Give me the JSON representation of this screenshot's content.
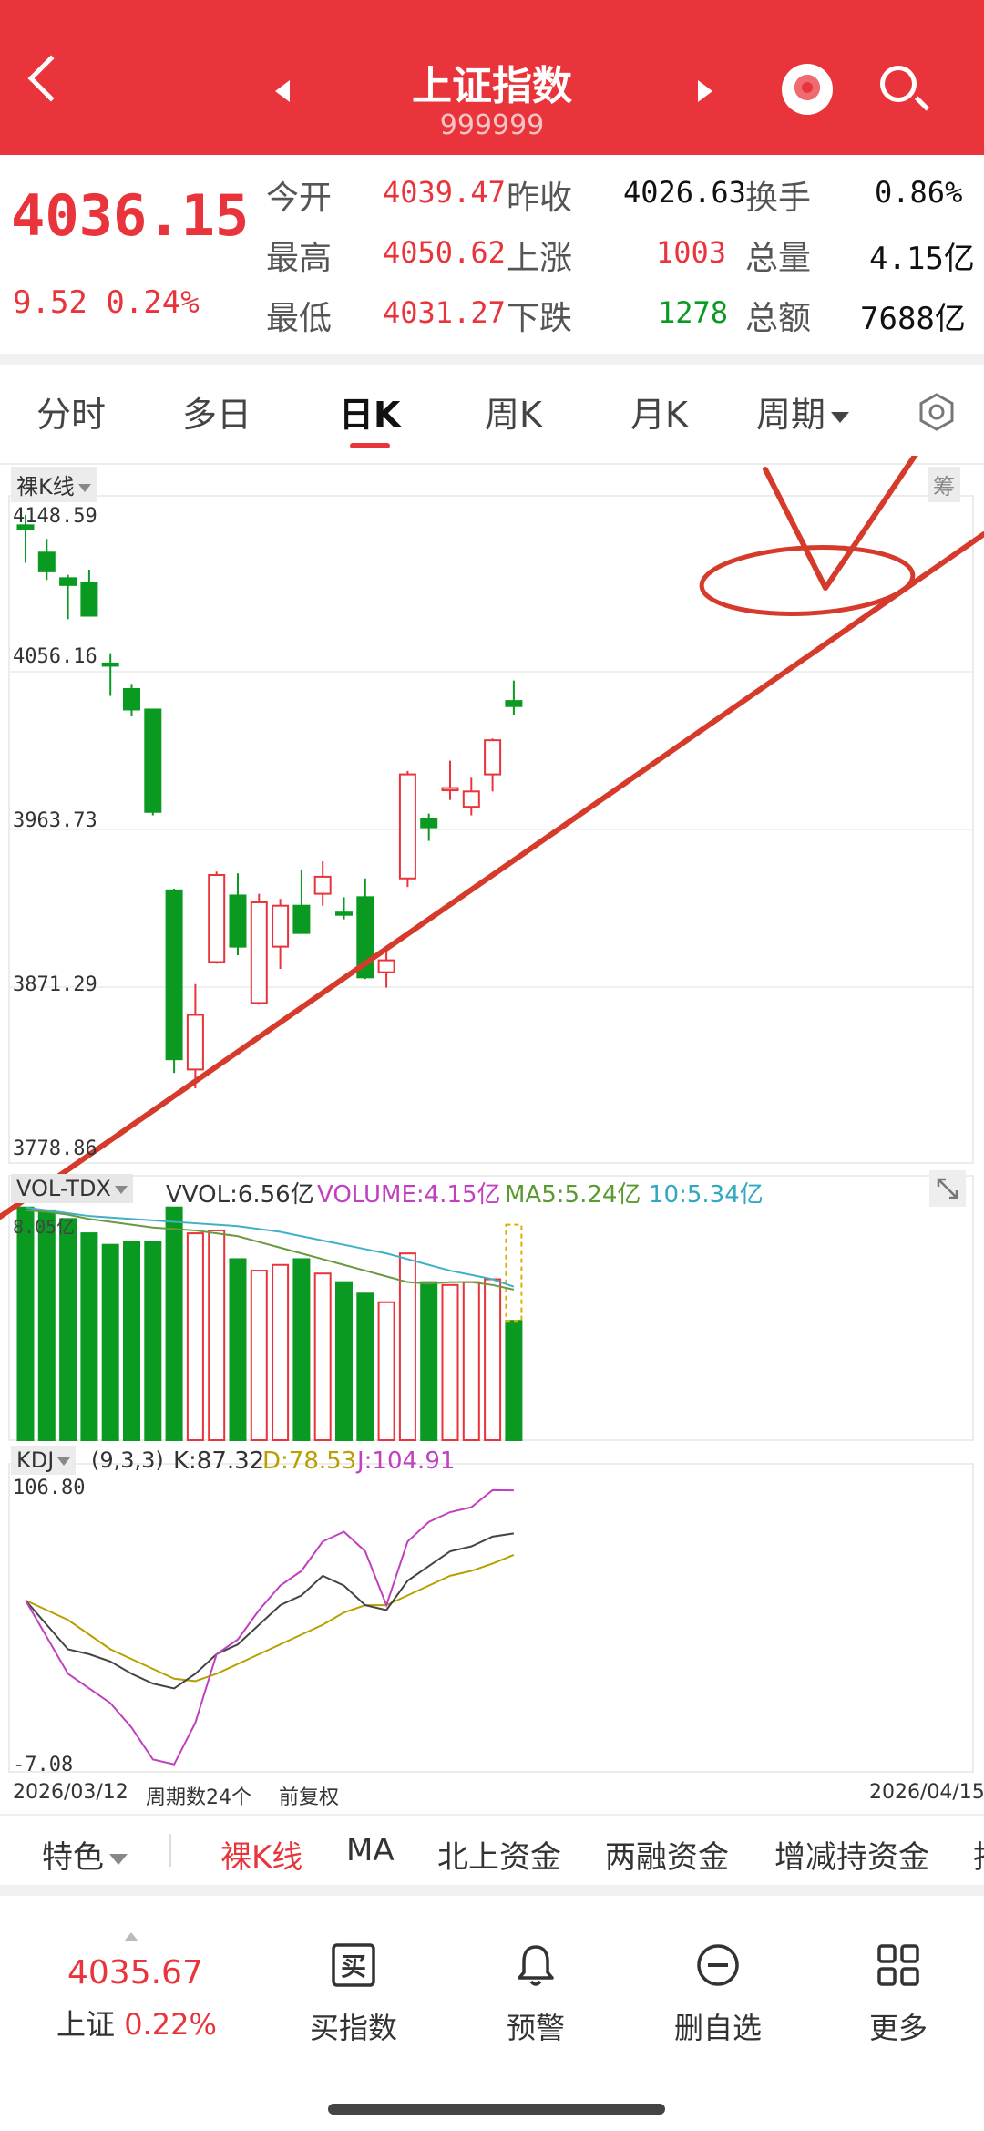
{
  "header": {
    "title": "上证指数",
    "code": "999999"
  },
  "quote": {
    "price": "4036.15",
    "change": "9.52  0.24%",
    "rows": [
      {
        "l1": "今开",
        "v1": "4039.47",
        "l2": "昨收",
        "v2": "4026.63",
        "l3": "换手",
        "v3": "0.86%"
      },
      {
        "l1": "最高",
        "v1": "4050.62",
        "l2": "上涨",
        "v2": "1003",
        "l3": "总量",
        "v3": "4.15亿"
      },
      {
        "l1": "最低",
        "v1": "4031.27",
        "l2": "下跌",
        "v2": "1278",
        "l3": "总额",
        "v3": "7688亿"
      }
    ]
  },
  "tabs": [
    "分时",
    "多日",
    "日K",
    "周K",
    "月K",
    "周期"
  ],
  "active_tab": "日K",
  "chart": {
    "kline_tag": "裸K线",
    "chip_tag": "筹",
    "price_labels": [
      "4148.59",
      "4056.16",
      "3963.73",
      "3871.29",
      "3778.86"
    ],
    "vol_tag": "VOL-TDX",
    "vol_legend": {
      "vvol": "VVOL:6.56亿",
      "volume": "VOLUME:4.15亿",
      "ma5": "MA5:5.24亿",
      "ma10": "10:5.34亿"
    },
    "vol_top_label": "8.05亿",
    "kdj_tag": "KDJ",
    "kdj_legend": {
      "params": "(9,3,3)",
      "k": "K:87.32",
      "d": "D:78.53",
      "j": "J:104.91"
    },
    "kdj_labels": [
      "106.80",
      "-7.08"
    ],
    "date_start": "2026/03/12",
    "period_count": "周期数24个",
    "adjust": "前复权",
    "date_end": "2026/04/15",
    "colors": {
      "up": "#e8343a",
      "down": "#0a9a21",
      "k": "#444444",
      "d": "#b8a000",
      "j": "#c040c0",
      "ma5": "#6a9a40",
      "ma10": "#40b0c8"
    }
  },
  "chart_data": {
    "type": "candlestick",
    "ylim": [
      3778.86,
      4148.59
    ],
    "candles": [
      {
        "o": 4142,
        "c": 4140,
        "h": 4148,
        "l": 4120
      },
      {
        "o": 4126,
        "c": 4115,
        "h": 4134,
        "l": 4110
      },
      {
        "o": 4111,
        "c": 4107,
        "h": 4113,
        "l": 4087
      },
      {
        "o": 4108,
        "c": 4089,
        "h": 4116,
        "l": 4089
      },
      {
        "o": 4061,
        "c": 4061,
        "h": 4067,
        "l": 4042
      },
      {
        "o": 4046,
        "c": 4034,
        "h": 4049,
        "l": 4030
      },
      {
        "o": 4034,
        "c": 3974,
        "h": 4034,
        "l": 3972
      },
      {
        "o": 3928,
        "c": 3829,
        "h": 3929,
        "l": 3821
      },
      {
        "o": 3823,
        "c": 3855,
        "h": 3873,
        "l": 3812
      },
      {
        "o": 3886,
        "c": 3937,
        "h": 3939,
        "l": 3885
      },
      {
        "o": 3925,
        "c": 3895,
        "h": 3938,
        "l": 3890
      },
      {
        "o": 3862,
        "c": 3921,
        "h": 3926,
        "l": 3861
      },
      {
        "o": 3895,
        "c": 3919,
        "h": 3923,
        "l": 3882
      },
      {
        "o": 3919,
        "c": 3903,
        "h": 3940,
        "l": 3903
      },
      {
        "o": 3926,
        "c": 3936,
        "h": 3945,
        "l": 3919
      },
      {
        "o": 3915,
        "c": 3915,
        "h": 3924,
        "l": 3911
      },
      {
        "o": 3924,
        "c": 3877,
        "h": 3935,
        "l": 3876
      },
      {
        "o": 3880,
        "c": 3887,
        "h": 3895,
        "l": 3871
      },
      {
        "o": 3935,
        "c": 3996,
        "h": 3998,
        "l": 3930
      },
      {
        "o": 3970,
        "c": 3965,
        "h": 3973,
        "l": 3957
      },
      {
        "o": 3987,
        "c": 3988,
        "h": 4004,
        "l": 3981
      },
      {
        "o": 3977,
        "c": 3986,
        "h": 3994,
        "l": 3972
      },
      {
        "o": 3996,
        "c": 4016,
        "h": 4017,
        "l": 3986
      },
      {
        "o": 4039,
        "c": 4036,
        "h": 4051,
        "l": 4031
      }
    ],
    "volume": [
      8.1,
      8.0,
      7.7,
      7.2,
      6.8,
      6.9,
      6.9,
      8.1,
      7.2,
      7.3,
      6.3,
      5.9,
      6.1,
      6.3,
      5.8,
      5.5,
      5.1,
      4.8,
      6.5,
      5.5,
      5.4,
      5.5,
      5.6,
      4.15
    ],
    "vol_max": 8.25,
    "ma5": [
      8.0,
      7.95,
      7.85,
      7.7,
      7.6,
      7.5,
      7.4,
      7.35,
      7.3,
      7.2,
      7.1,
      6.9,
      6.7,
      6.5,
      6.3,
      6.1,
      5.9,
      5.7,
      5.5,
      5.45,
      5.5,
      5.5,
      5.4,
      5.24
    ],
    "ma10": [
      8.1,
      8.0,
      7.9,
      7.8,
      7.75,
      7.7,
      7.65,
      7.6,
      7.55,
      7.5,
      7.45,
      7.35,
      7.25,
      7.1,
      6.95,
      6.8,
      6.65,
      6.5,
      6.3,
      6.1,
      5.9,
      5.75,
      5.6,
      5.34
    ],
    "kdj_ylim": [
      -7.08,
      106.8
    ],
    "k": [
      60,
      50,
      40,
      38,
      35,
      30,
      26,
      24,
      30,
      38,
      42,
      50,
      58,
      62,
      70,
      66,
      58,
      56,
      68,
      74,
      80,
      82,
      86,
      87.32
    ],
    "d": [
      60,
      56,
      52,
      46,
      40,
      36,
      32,
      28,
      27,
      30,
      34,
      38,
      42,
      46,
      50,
      55,
      58,
      58,
      62,
      66,
      70,
      72,
      75,
      78.53
    ],
    "j": [
      60,
      45,
      30,
      24,
      18,
      8,
      -5,
      -7,
      10,
      38,
      44,
      56,
      66,
      72,
      84,
      88,
      80,
      58,
      84,
      92,
      96,
      98,
      105,
      104.91
    ]
  },
  "toolbar": {
    "feature": "特色",
    "items": [
      "裸K线",
      "MA",
      "北上资金",
      "两融资金",
      "增减持资金",
      "抄"
    ],
    "active": "裸K线"
  },
  "bottom": {
    "price": "4035.67",
    "name": "上证",
    "pct": "0.22%",
    "buy": "买指数",
    "alert": "预警",
    "remove": "删自选",
    "more": "更多"
  }
}
